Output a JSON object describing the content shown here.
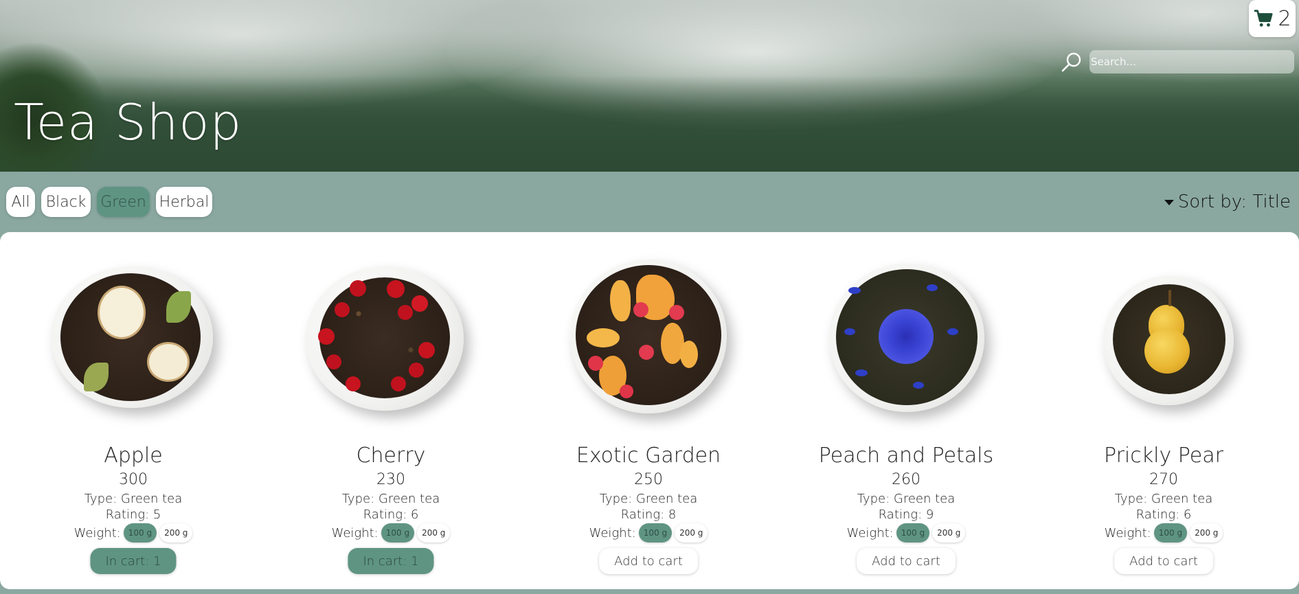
{
  "header": {
    "title": "Tea Shop",
    "cart_count": "2",
    "search_placeholder": "Search..."
  },
  "filters": {
    "items": [
      {
        "label": "All",
        "active": false
      },
      {
        "label": "Black",
        "active": false
      },
      {
        "label": "Green",
        "active": true
      },
      {
        "label": "Herbal",
        "active": false
      }
    ],
    "sort_label": "Sort by: Title"
  },
  "products": [
    {
      "name": "Apple",
      "price": "300",
      "type": "Type: Green tea",
      "rating": "Rating: 5",
      "weight_label": "Weight:",
      "weights": [
        "100 g",
        "200 g"
      ],
      "selected_weight": "100 g",
      "cart_label": "In cart: 1",
      "in_cart": true,
      "image": "apple-tea-plate"
    },
    {
      "name": "Cherry",
      "price": "230",
      "type": "Type: Green tea",
      "rating": "Rating: 6",
      "weight_label": "Weight:",
      "weights": [
        "100 g",
        "200 g"
      ],
      "selected_weight": "100 g",
      "cart_label": "In cart: 1",
      "in_cart": true,
      "image": "cherry-tea-plate"
    },
    {
      "name": "Exotic Garden",
      "price": "250",
      "type": "Type: Green tea",
      "rating": "Rating: 8",
      "weight_label": "Weight:",
      "weights": [
        "100 g",
        "200 g"
      ],
      "selected_weight": "100 g",
      "cart_label": "Add to cart",
      "in_cart": false,
      "image": "exotic-garden-tea-plate"
    },
    {
      "name": "Peach and Petals",
      "price": "260",
      "type": "Type: Green tea",
      "rating": "Rating: 9",
      "weight_label": "Weight:",
      "weights": [
        "100 g",
        "200 g"
      ],
      "selected_weight": "100 g",
      "cart_label": "Add to cart",
      "in_cart": false,
      "image": "peach-petals-tea-plate"
    },
    {
      "name": "Prickly Pear",
      "price": "270",
      "type": "Type: Green tea",
      "rating": "Rating: 6",
      "weight_label": "Weight:",
      "weights": [
        "100 g",
        "200 g"
      ],
      "selected_weight": "100 g",
      "cart_label": "Add to cart",
      "in_cart": false,
      "image": "prickly-pear-tea-plate"
    }
  ],
  "colors": {
    "accent": "#5f9483",
    "filter_bar_bg": "#8aa8a0",
    "panel_bg": "#ffffff"
  },
  "icons": {
    "cart": "cart-icon",
    "search": "search-icon",
    "sort_caret": "caret-down-icon"
  }
}
